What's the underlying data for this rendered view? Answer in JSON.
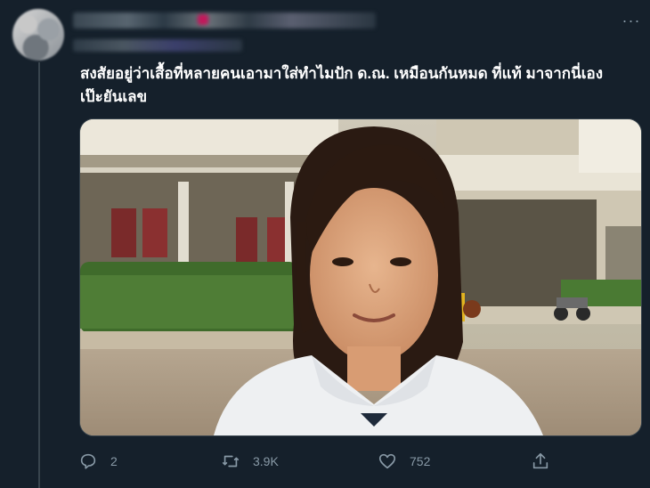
{
  "tweet": {
    "text_line1": "สงสัยอยู่ว่าเสื้อที่หลายคนเอามาใส่ทำไมปัก ด.ณ. เหมือนกันหมด ที่แท้ มาจากนี่เอง",
    "text_line2": "เป๊ะยันเลข",
    "more_icon": "···"
  },
  "actions": {
    "reply_count": "2",
    "retweet_count": "3.9K",
    "like_count": "752"
  },
  "icons": {
    "reply": "reply-icon",
    "retweet": "retweet-icon",
    "like": "heart-icon",
    "share": "share-icon"
  },
  "colors": {
    "background": "#15202b",
    "text": "#ffffff",
    "muted": "#8899a6",
    "border": "#38444d"
  }
}
